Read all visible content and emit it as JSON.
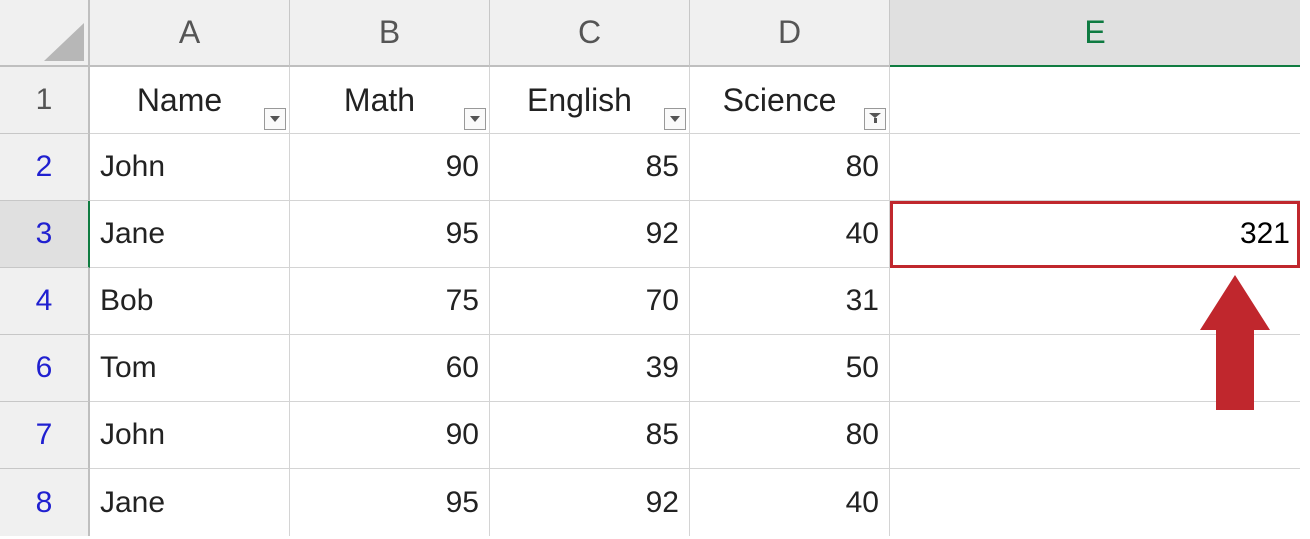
{
  "columns": {
    "A": "A",
    "B": "B",
    "C": "C",
    "D": "D",
    "E": "E"
  },
  "row_labels": {
    "r1": "1",
    "r2": "2",
    "r3": "3",
    "r4": "4",
    "r6": "6",
    "r7": "7",
    "r8": "8"
  },
  "headers": {
    "name": "Name",
    "math": "Math",
    "english": "English",
    "science": "Science"
  },
  "rows": [
    {
      "name": "John",
      "math": "90",
      "english": "85",
      "science": "80"
    },
    {
      "name": "Jane",
      "math": "95",
      "english": "92",
      "science": "40"
    },
    {
      "name": "Bob",
      "math": "75",
      "english": "70",
      "science": "31"
    },
    {
      "name": "Tom",
      "math": "60",
      "english": "39",
      "science": "50"
    },
    {
      "name": "John",
      "math": "90",
      "english": "85",
      "science": "80"
    },
    {
      "name": "Jane",
      "math": "95",
      "english": "92",
      "science": "40"
    }
  ],
  "result_cell": {
    "value": "321"
  }
}
